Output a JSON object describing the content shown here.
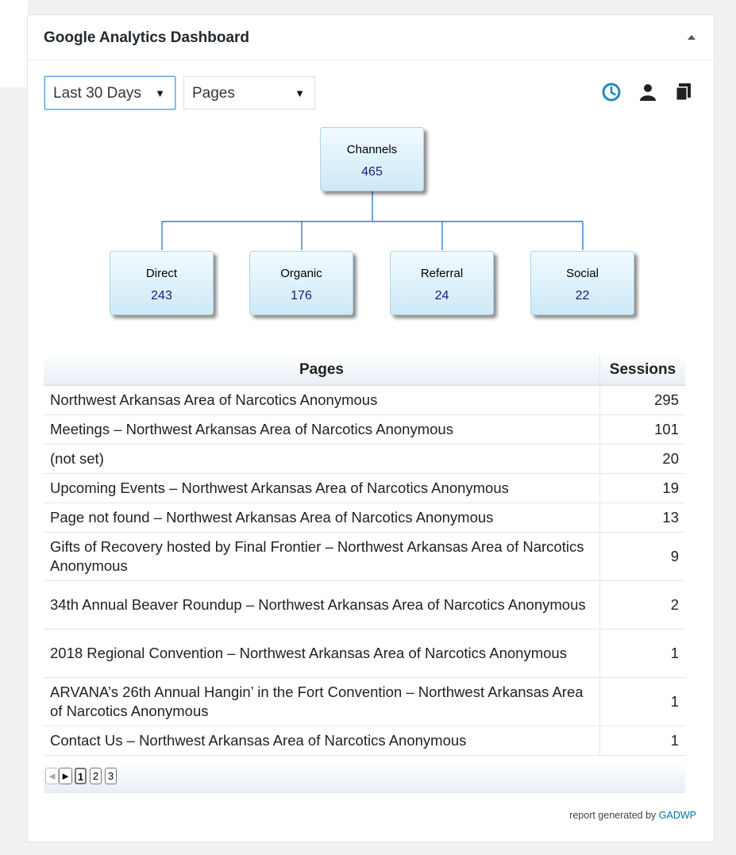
{
  "widget": {
    "title": "Google Analytics Dashboard"
  },
  "controls": {
    "period_selected": "Last 30 Days",
    "report_selected": "Pages"
  },
  "icons": {
    "collapse": "triangle-up-icon",
    "realtime": "clock-icon",
    "audience": "user-icon",
    "pages": "copy-icon"
  },
  "tree": {
    "root": {
      "label": "Channels",
      "value": "465"
    },
    "children": [
      {
        "label": "Direct",
        "value": "243"
      },
      {
        "label": "Organic",
        "value": "176"
      },
      {
        "label": "Referral",
        "value": "24"
      },
      {
        "label": "Social",
        "value": "22"
      }
    ]
  },
  "table": {
    "headers": {
      "pages": "Pages",
      "sessions": "Sessions"
    },
    "rows": [
      {
        "page": "Northwest Arkansas Area of Narcotics Anonymous",
        "sessions": "295"
      },
      {
        "page": "Meetings – Northwest Arkansas Area of Narcotics Anonymous",
        "sessions": "101"
      },
      {
        "page": "(not set)",
        "sessions": "20"
      },
      {
        "page": "Upcoming Events – Northwest Arkansas Area of Narcotics Anonymous",
        "sessions": "19"
      },
      {
        "page": "Page not found – Northwest Arkansas Area of Narcotics Anonymous",
        "sessions": "13"
      },
      {
        "page": "Gifts of Recovery hosted by Final Frontier – Northwest Arkansas Area of Narcotics Anonymous",
        "sessions": "9"
      },
      {
        "page": "34th Annual Beaver Roundup – Northwest Arkansas Area of Narcotics Anonymous",
        "sessions": "2"
      },
      {
        "page": "2018 Regional Convention – Northwest Arkansas Area of Narcotics Anonymous",
        "sessions": "1"
      },
      {
        "page": "ARVANA’s 26th Annual Hangin’ in the Fort Convention – Northwest Arkansas Area of Narcotics Anonymous",
        "sessions": "1"
      },
      {
        "page": "Contact Us – Northwest Arkansas Area of Narcotics Anonymous",
        "sessions": "1"
      }
    ]
  },
  "pagination": {
    "prev": "◄",
    "next": "►",
    "pages": [
      "1",
      "2",
      "3"
    ]
  },
  "footer": {
    "text": "report generated by",
    "link": "GADWP"
  },
  "colors": {
    "accent_blue": "#0073aa",
    "node_value": "#1a1a80",
    "connector": "#2f7fd0"
  }
}
